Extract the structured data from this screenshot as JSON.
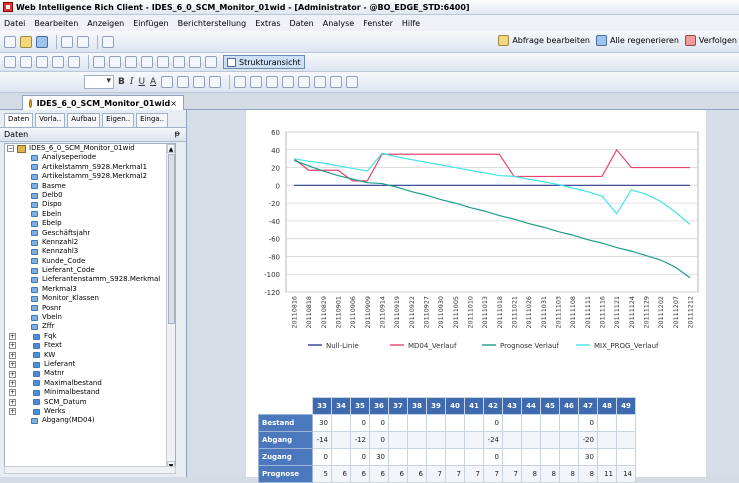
{
  "window": {
    "title": "Web Intelligence Rich Client - IDES_6_0_SCM_Monitor_01wid - [Administrator - @BO_EDGE_STD:6400]"
  },
  "menu": [
    "Datei",
    "Bearbeiten",
    "Anzeigen",
    "Einfügen",
    "Berichterstellung",
    "Extras",
    "Daten",
    "Analyse",
    "Fenster",
    "Hilfe"
  ],
  "toolbar": {
    "query_button": "Abfrage bearbeiten",
    "refresh_button": "Alle regenerieren",
    "track_button": "Verfolgen",
    "structure_button": "Strukturansicht"
  },
  "document_tab": {
    "label": "IDES_6_0_SCM_Monitor_01wid",
    "close": "×"
  },
  "left_panel": {
    "tabs": [
      "Daten",
      "Vorla..",
      "Aufbau",
      "Eigen..",
      "Einga.."
    ],
    "header": "Daten",
    "pin": "ᵽ",
    "root": "IDES_6_0_SCM_Monitor_01wid",
    "items": [
      "Analyseperiode",
      "Artikelstamm_S928.Merkmal1",
      "Artikelstamm_S928.Merkmal2",
      "Basme",
      "Delb0",
      "Dispo",
      "Ebeln",
      "Ebelp",
      "Geschäftsjahr",
      "Kennzahl2",
      "Kennzahl3",
      "Kunde_Code",
      "Lieferant_Code",
      "Lieferantenstamm_S928.Merkmal",
      "Merkmal3",
      "Monitor_Klassen",
      "Posnr",
      "Vbeln",
      "Zffr"
    ],
    "folders": [
      "Fqk",
      "Ftext",
      "KW",
      "Lieferant",
      "Matnr",
      "Maximalbestand",
      "Minimalbestand",
      "SCM_Datum",
      "Werks"
    ],
    "last_partial": "Abgang(MD04)"
  },
  "chart_data": {
    "type": "line",
    "ylim": [
      -120,
      60
    ],
    "yticks": [
      60,
      40,
      20,
      0,
      -20,
      -40,
      -60,
      -80,
      -100,
      -120
    ],
    "x": [
      "20110816",
      "20110818",
      "20110829",
      "20110901",
      "20110906",
      "20110909",
      "20110914",
      "20110919",
      "20110922",
      "20110927",
      "20110930",
      "20111005",
      "20111010",
      "20111013",
      "20111018",
      "20111021",
      "20111026",
      "20111031",
      "20111103",
      "20111108",
      "20111111",
      "20111116",
      "20111121",
      "20111124",
      "20111129",
      "20111202",
      "20111207",
      "20111212"
    ],
    "series": [
      {
        "name": "Null-Linie",
        "color": "#2b3f8f",
        "values": [
          0,
          0,
          0,
          0,
          0,
          0,
          0,
          0,
          0,
          0,
          0,
          0,
          0,
          0,
          0,
          0,
          0,
          0,
          0,
          0,
          0,
          0,
          0,
          0,
          0,
          0,
          0,
          0
        ]
      },
      {
        "name": "MD04_Verlauf",
        "color": "#e8456b",
        "values": [
          30,
          17,
          17,
          17,
          5,
          5,
          35,
          35,
          35,
          35,
          35,
          35,
          35,
          35,
          35,
          10,
          10,
          10,
          10,
          10,
          10,
          10,
          40,
          20,
          20,
          20,
          20,
          20
        ]
      },
      {
        "name": "Prognose Verlauf",
        "color": "#1f9b8a",
        "values": [
          28,
          22,
          16,
          11,
          7,
          3,
          2,
          -2,
          -7,
          -11,
          -16,
          -20,
          -25,
          -29,
          -34,
          -38,
          -43,
          -47,
          -52,
          -56,
          -61,
          -65,
          -70,
          -74,
          -79,
          -84,
          -92,
          -104
        ]
      },
      {
        "name": "MIX_PROG_Verlauf",
        "color": "#44e3e6",
        "values": [
          30,
          27,
          25,
          22,
          19,
          16,
          36,
          32,
          29,
          26,
          23,
          20,
          17,
          14,
          11,
          10,
          7,
          4,
          1,
          -3,
          -7,
          -12,
          -32,
          -5,
          -10,
          -18,
          -30,
          -44
        ]
      }
    ]
  },
  "table": {
    "columns": [
      "33",
      "34",
      "35",
      "36",
      "37",
      "38",
      "39",
      "40",
      "41",
      "42",
      "43",
      "44",
      "45",
      "46",
      "47",
      "48",
      "49"
    ],
    "rows": [
      {
        "label": "Bestand",
        "cells": [
          "30",
          "",
          "0",
          "0",
          "",
          "",
          "",
          "",
          "",
          "0",
          "",
          "",
          "",
          "",
          "0",
          "",
          ""
        ]
      },
      {
        "label": "Abgang",
        "cells": [
          "-14",
          "",
          "-12",
          "0",
          "",
          "",
          "",
          "",
          "",
          "-24",
          "",
          "",
          "",
          "",
          "-20",
          "",
          ""
        ]
      },
      {
        "label": "Zugang",
        "cells": [
          "0",
          "",
          "0",
          "30",
          "",
          "",
          "",
          "",
          "",
          "0",
          "",
          "",
          "",
          "",
          "30",
          "",
          ""
        ]
      },
      {
        "label": "Prognose",
        "cells": [
          "5",
          "6",
          "6",
          "6",
          "6",
          "6",
          "7",
          "7",
          "7",
          "7",
          "7",
          "8",
          "8",
          "8",
          "8",
          "11",
          "14"
        ]
      }
    ]
  }
}
